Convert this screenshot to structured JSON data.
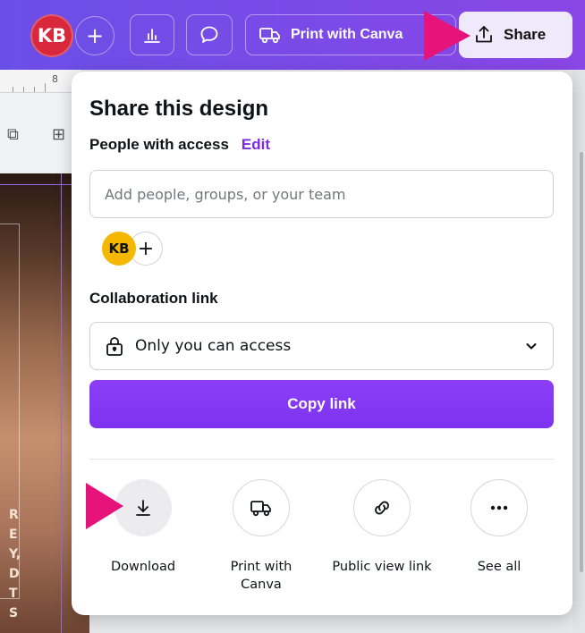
{
  "topbar": {
    "avatar_initials": "KB",
    "add_label": "+",
    "print_label": "Print with Canva",
    "share_label": "Share"
  },
  "editor": {
    "ruler_number": "8",
    "photo_letters": [
      "R",
      "E",
      "Y,",
      "D",
      "T",
      "S"
    ]
  },
  "share_panel": {
    "title": "Share this design",
    "people_access_label": "People with access",
    "edit_label": "Edit",
    "people_input_placeholder": "Add people, groups, or your team",
    "member_initials": "KB",
    "add_member_label": "+",
    "collaboration_label": "Collaboration link",
    "access_value": "Only you can access",
    "copy_link_label": "Copy link",
    "actions": [
      {
        "label": "Download",
        "icon": "download-icon"
      },
      {
        "label": "Print with Canva",
        "icon": "truck-icon"
      },
      {
        "label": "Public view link",
        "icon": "link-icon"
      },
      {
        "label": "See all",
        "icon": "more-icon"
      }
    ]
  },
  "colors": {
    "topbar_start": "#6a4fe6",
    "topbar_end": "#8a46e6",
    "accent": "#8b3dff",
    "edit_link": "#7d2ae8",
    "avatar_top": "#d9273b",
    "avatar_member": "#f5b800",
    "annotation_arrow": "#e6137a"
  }
}
